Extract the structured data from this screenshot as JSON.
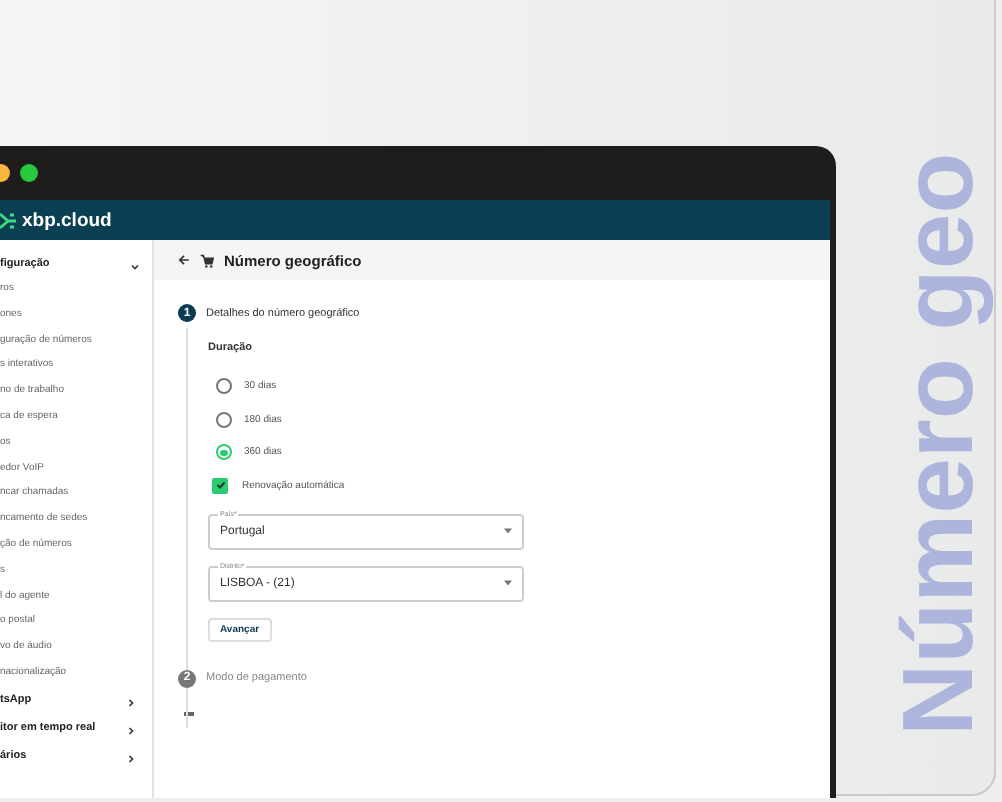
{
  "side_title": "Número geo",
  "window": {
    "brand": "xbp.cloud"
  },
  "sidebar": {
    "section": {
      "label": "figuração",
      "expanded": true
    },
    "items": [
      {
        "label": "ros"
      },
      {
        "label": "ones"
      },
      {
        "label": "guração de números"
      },
      {
        "label": "s interativos"
      },
      {
        "label": "no de trabalho"
      },
      {
        "label": "ca de espera"
      },
      {
        "label": "os"
      },
      {
        "label": "edor VoIP"
      },
      {
        "label": "ncar chamadas"
      },
      {
        "label": "ncamento de sedes"
      },
      {
        "label": "ção de números"
      },
      {
        "label": "s"
      },
      {
        "label": "l do agente"
      },
      {
        "label": "o postal"
      },
      {
        "label": "vo de áudio"
      },
      {
        "label": "nacionalização"
      }
    ],
    "groups": [
      {
        "label": "tsApp",
        "expanded": false
      },
      {
        "label": "itor em tempo real",
        "expanded": false
      },
      {
        "label": "ários",
        "expanded": false
      }
    ]
  },
  "page": {
    "title": "Número geográfico"
  },
  "steps": [
    {
      "number": "1",
      "label": "Detalhes do número geográfico",
      "active": true
    },
    {
      "number": "2",
      "label": "Modo de pagamento",
      "active": false
    }
  ],
  "form": {
    "duration_label": "Duração",
    "durations": [
      {
        "label": "30 dias",
        "selected": false
      },
      {
        "label": "180 dias",
        "selected": false
      },
      {
        "label": "360 dias",
        "selected": true
      }
    ],
    "auto_renew": {
      "label": "Renovação automática",
      "checked": true
    },
    "selects": [
      {
        "label": "País*",
        "value": "Portugal"
      },
      {
        "label": "Distrito*",
        "value": "LISBOA - (21)"
      }
    ],
    "submit": "Avançar"
  }
}
